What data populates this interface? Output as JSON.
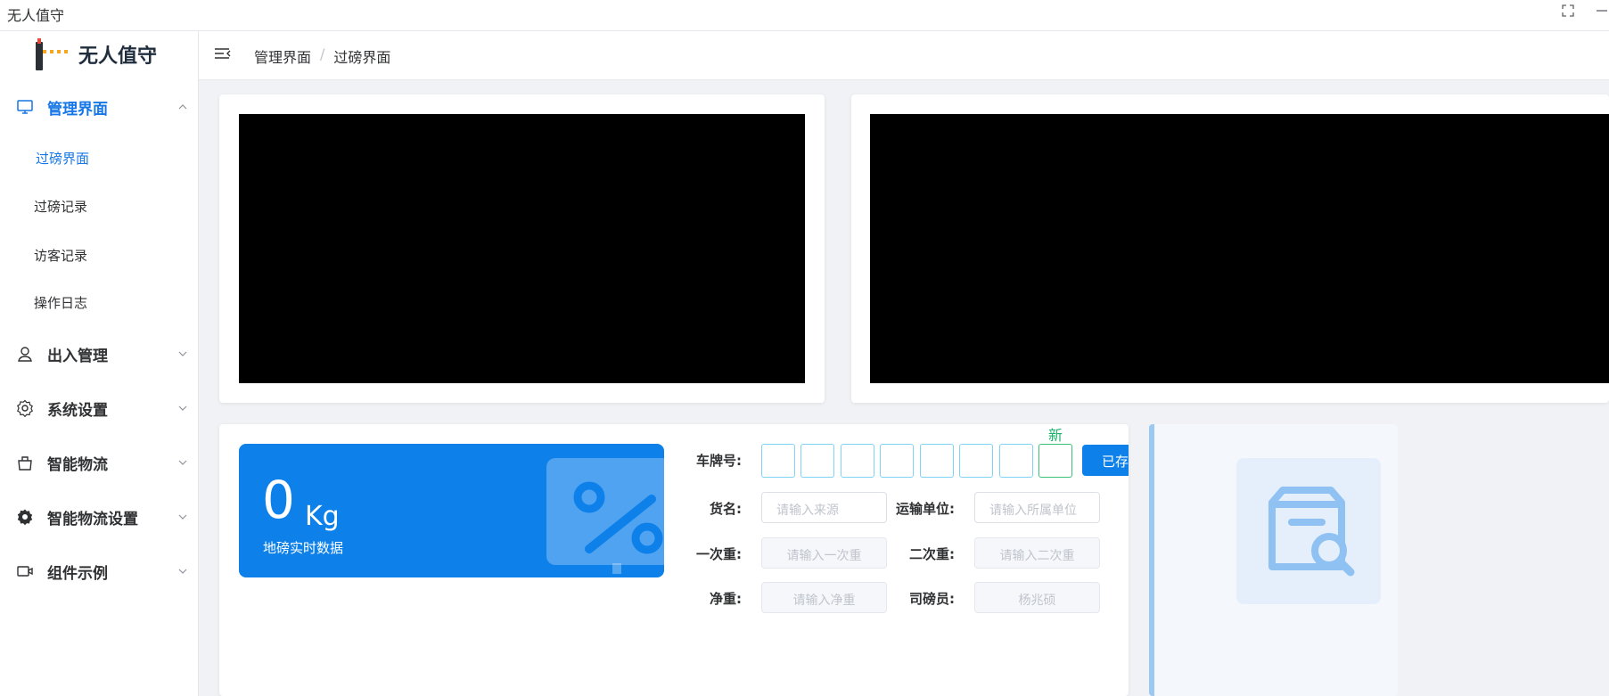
{
  "window": {
    "title": "无人值守"
  },
  "logo": {
    "text": "无人值守"
  },
  "sidebar": {
    "groups": [
      {
        "label": "管理界面",
        "icon": "monitor-icon",
        "expanded": true,
        "active": true,
        "children": [
          {
            "label": "过磅界面",
            "active": true
          },
          {
            "label": "过磅记录"
          },
          {
            "label": "访客记录"
          },
          {
            "label": "操作日志"
          }
        ]
      },
      {
        "label": "出入管理",
        "icon": "user-icon"
      },
      {
        "label": "系统设置",
        "icon": "settings-icon"
      },
      {
        "label": "智能物流",
        "icon": "bag-icon"
      },
      {
        "label": "智能物流设置",
        "icon": "gear-icon"
      },
      {
        "label": "组件示例",
        "icon": "video-icon"
      }
    ]
  },
  "breadcrumb": {
    "items": [
      "管理界面",
      "过磅界面"
    ],
    "separator": "/"
  },
  "weight": {
    "value": "0",
    "unit": "Kg",
    "caption": "地磅实时数据"
  },
  "form": {
    "plate_label": "车牌号:",
    "new_tag": "新",
    "saved_button": "已存",
    "goods_label": "货名:",
    "goods_placeholder": "请输入来源",
    "transport_label": "运输单位:",
    "transport_placeholder": "请输入所属单位",
    "first_weight_label": "一次重:",
    "first_weight_placeholder": "请输入一次重",
    "second_weight_label": "二次重:",
    "second_weight_placeholder": "请输入二次重",
    "net_weight_label": "净重:",
    "net_weight_placeholder": "请输入净重",
    "weigher_label": "司磅员:",
    "weigher_value": "杨兆硕"
  },
  "colors": {
    "accent": "#1677e6",
    "weight_card": "#0d80ea",
    "new_tag": "#1bb36a"
  }
}
